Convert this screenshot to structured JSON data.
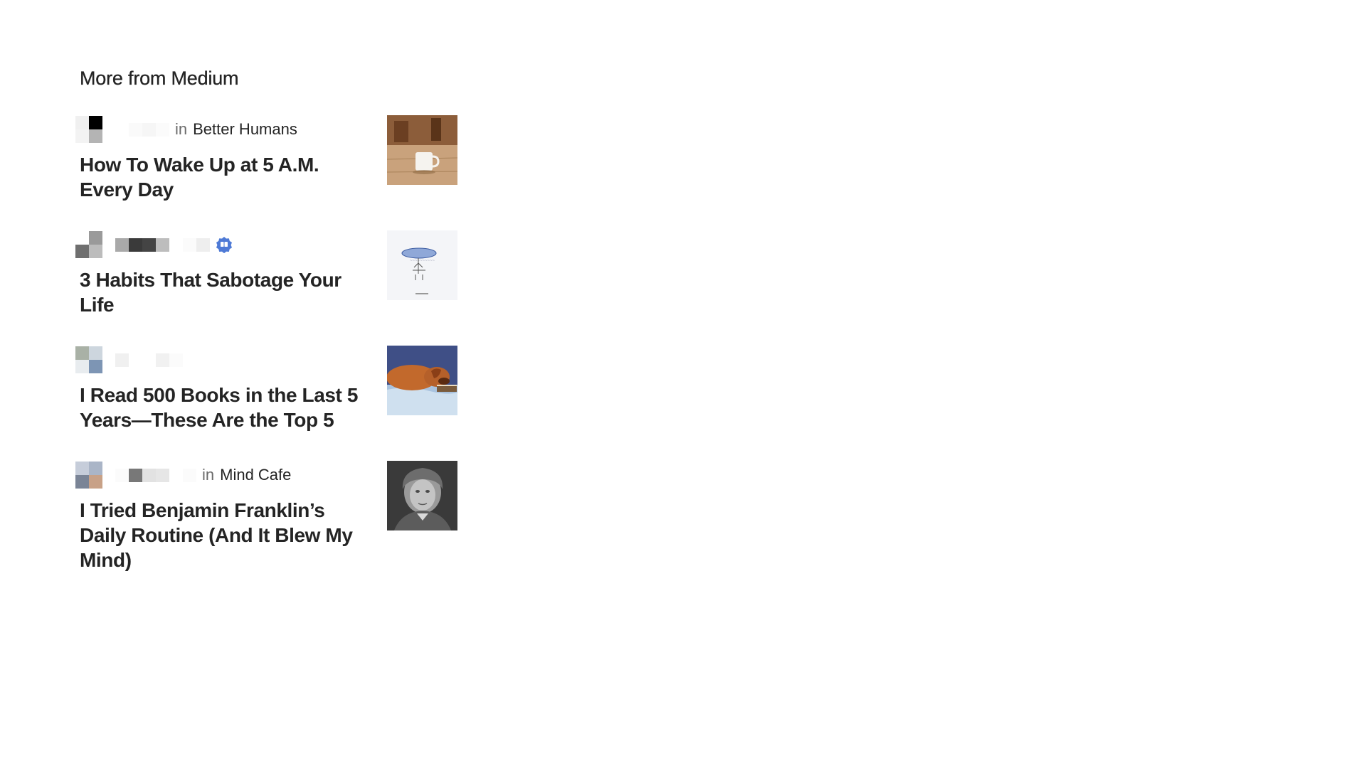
{
  "section": {
    "title": "More from Medium"
  },
  "articles": [
    {
      "in_label": "in",
      "publication": "Better Humans",
      "title": "How To Wake Up at 5 A.M. Every Day",
      "thumbnail": "coffee-mug-on-table-image",
      "verified": false
    },
    {
      "in_label": "",
      "publication": "",
      "title": "3 Habits That Sabotage Your Life",
      "thumbnail": "umbrella-sketch-illustration-image",
      "verified": true
    },
    {
      "in_label": "",
      "publication": "",
      "title": "I Read 500 Books in the Last 5 Years—These Are the Top 5",
      "thumbnail": "sleeping-dog-on-book-image",
      "verified": false
    },
    {
      "in_label": "in",
      "publication": "Mind Cafe",
      "title": "I Tried Benjamin Franklin’s Daily Routine (And It Blew My Mind)",
      "thumbnail": "benjamin-franklin-portrait-image",
      "verified": false
    }
  ],
  "colors": {
    "text": "#242424",
    "muted": "#6b6b6b",
    "verified_badge": "#4e7ad6"
  }
}
